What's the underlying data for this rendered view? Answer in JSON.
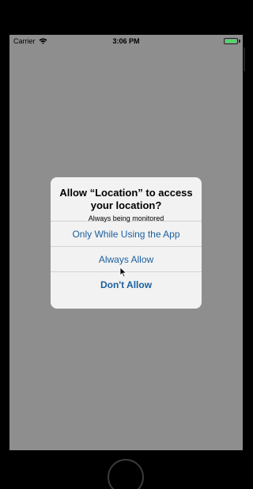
{
  "status_bar": {
    "carrier": "Carrier",
    "time": "3:06 PM",
    "battery_color": "#4cd964",
    "wifi_icon": "wifi-icon",
    "battery_icon": "battery-icon"
  },
  "dialog": {
    "title": "Allow “Location” to access your location?",
    "message": "Always being monitored",
    "buttons": [
      {
        "label": "Only While Using the App"
      },
      {
        "label": "Always Allow"
      },
      {
        "label": "Don't Allow"
      }
    ],
    "accent_color": "#1a5f9e"
  },
  "device": {
    "home_button_icon": "home-button-icon"
  }
}
